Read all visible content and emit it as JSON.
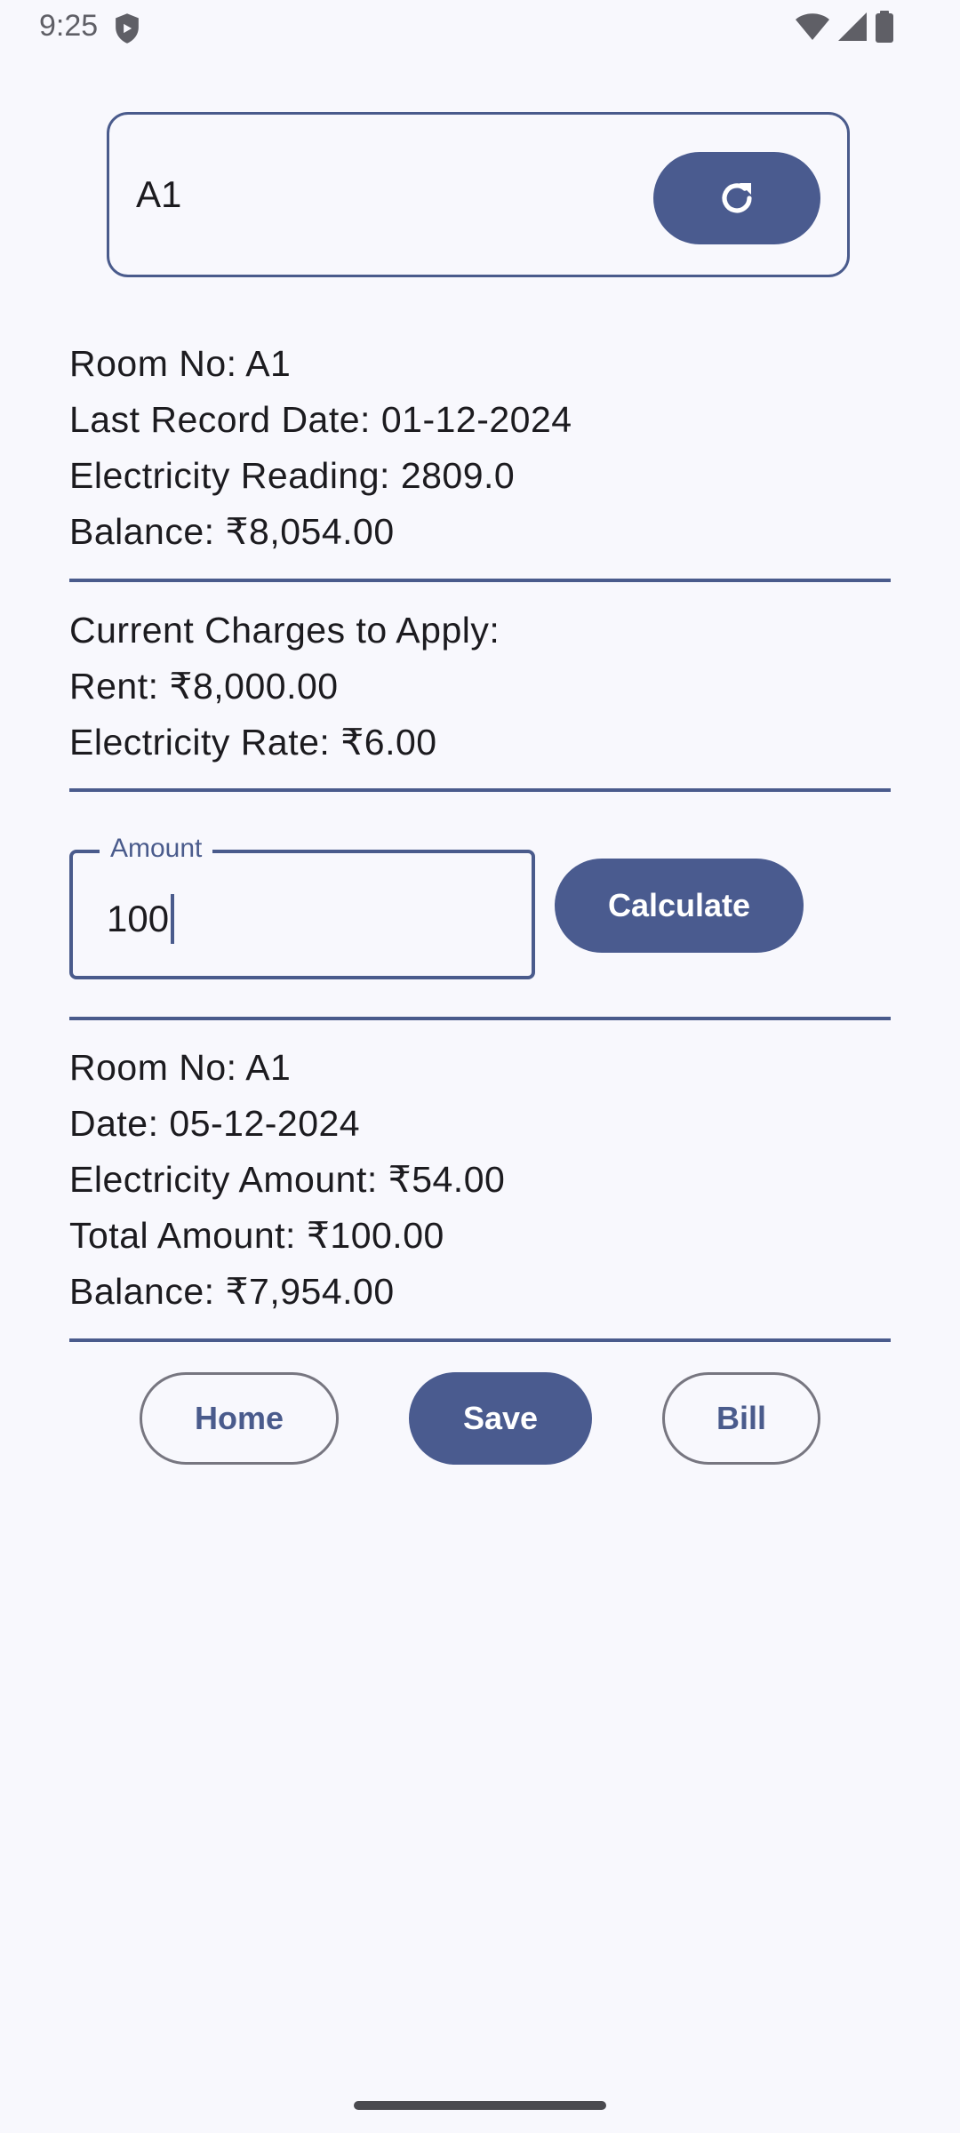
{
  "status_bar": {
    "time": "9:25",
    "icons": [
      "shield-icon",
      "wifi-icon",
      "signal-icon",
      "battery-icon"
    ]
  },
  "room_selector": {
    "value": "A1",
    "refresh_icon": "refresh-icon"
  },
  "last_record": {
    "room_no": "Room No: A1",
    "last_record_date": "Last Record Date: 01-12-2024",
    "electricity_reading": "Electricity Reading: 2809.0",
    "balance": "Balance: ₹8,054.00"
  },
  "current_charges": {
    "heading": "Current Charges to Apply:",
    "rent": "Rent: ₹8,000.00",
    "electricity_rate": "Electricity Rate: ₹6.00"
  },
  "amount_input": {
    "label": "Amount",
    "value": "100"
  },
  "calculate_label": "Calculate",
  "result": {
    "room_no": "Room No: A1",
    "date": "Date: 05-12-2024",
    "electricity_amount": "Electricity Amount: ₹54.00",
    "total_amount": "Total Amount: ₹100.00",
    "balance": "Balance: ₹7,954.00"
  },
  "actions": {
    "home_label": "Home",
    "save_label": "Save",
    "bill_label": "Bill"
  },
  "colors": {
    "primary": "#4a5b8f",
    "background": "#f8f8fd",
    "outline": "#777680"
  }
}
